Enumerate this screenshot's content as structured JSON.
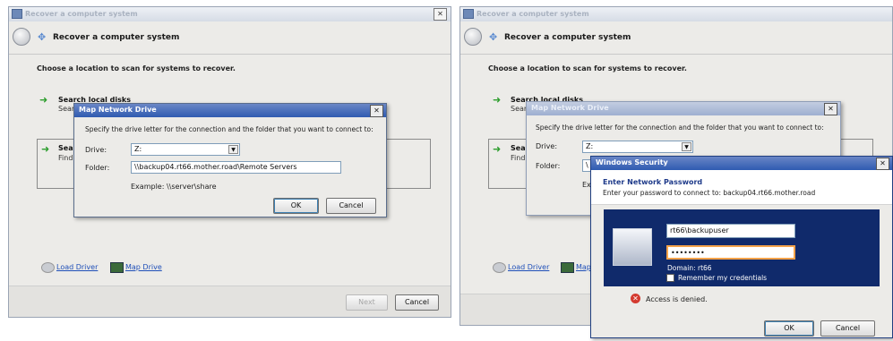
{
  "left": {
    "window_title": "Recover a computer system",
    "header_title": "Recover a computer system",
    "prompt": "Choose a location to scan for systems to recover.",
    "option1_label": "Search local disks",
    "option1_sub": "Sear",
    "option2_label": "Sea",
    "option2_sub": "Find",
    "load_driver": "Load Driver",
    "map_drive": "Map Drive",
    "next_button": "Next",
    "cancel_button": "Cancel",
    "map_dialog": {
      "title": "Map Network Drive",
      "instruction": "Specify the drive letter for the connection and the folder that you want to connect to:",
      "drive_label": "Drive:",
      "drive_value": "Z:",
      "folder_label": "Folder:",
      "folder_value": "\\\\backup04.rt66.mother.road\\Remote Servers",
      "example": "Example: \\\\server\\share",
      "ok_button": "OK",
      "cancel_button": "Cancel"
    }
  },
  "right": {
    "window_title": "Recover a computer system",
    "header_title": "Recover a computer system",
    "prompt": "Choose a location to scan for systems to recover.",
    "option1_label": "Search local disks",
    "option1_sub": "Sear",
    "option2_label": "Sea",
    "option2_sub": "Find",
    "load_driver": "Load Driver",
    "map_drive": "Map",
    "map_dialog": {
      "title": "Map Network Drive",
      "instruction": "Specify the drive letter for the connection and the folder that you want to connect to:",
      "drive_label": "Drive:",
      "drive_value": "Z:",
      "folder_label": "Folder:",
      "folder_value": "\\",
      "example": "Ex"
    },
    "security_dialog": {
      "title": "Windows Security",
      "heading": "Enter Network Password",
      "description": "Enter your password to connect to: backup04.rt66.mother.road",
      "username": "rt66\\backupuser",
      "password": "••••••••",
      "domain": "Domain: rt66",
      "remember": "Remember my credentials",
      "error": "Access is denied.",
      "ok_button": "OK",
      "cancel_button": "Cancel"
    }
  },
  "colors": {
    "accent": "#2f5bb1",
    "credential_panel": "#102a6b",
    "arrow": "#2e9e2e",
    "error": "#d43a2f"
  }
}
